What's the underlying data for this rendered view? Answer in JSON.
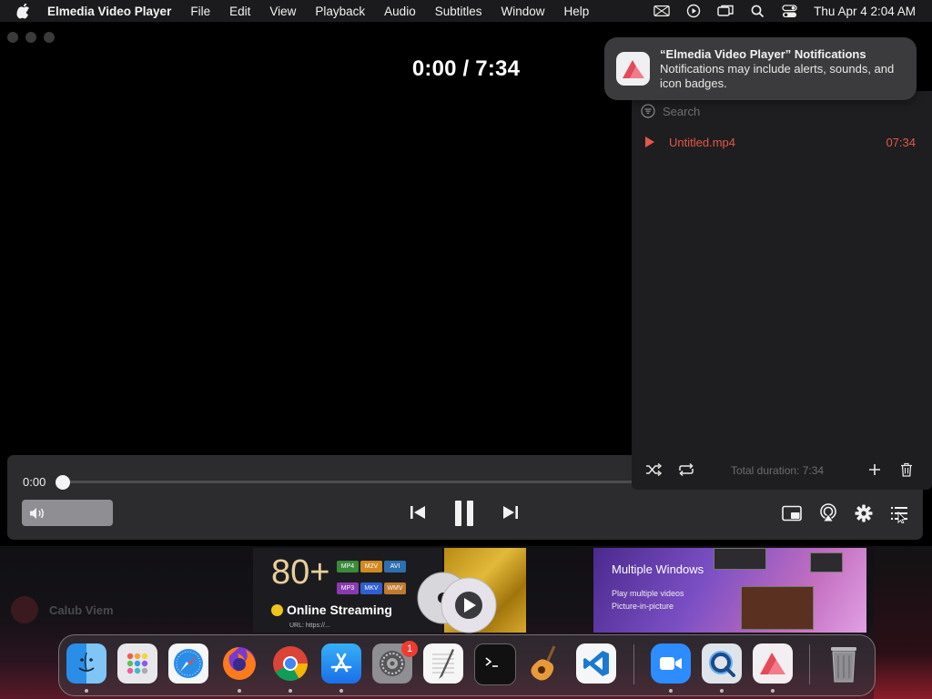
{
  "menubar": {
    "app_name": "Elmedia Video Player",
    "items": [
      "File",
      "Edit",
      "View",
      "Playback",
      "Audio",
      "Subtitles",
      "Window",
      "Help"
    ],
    "clock": "Thu Apr 4  2:04 AM"
  },
  "player": {
    "time_display": "0:00 / 7:34",
    "current_time": "0:00",
    "progress": 0,
    "volume": 1.0
  },
  "playlist": {
    "search_placeholder": "Search",
    "items": [
      {
        "name": "Untitled.mp4",
        "duration": "07:34"
      }
    ],
    "total_duration": "Total duration: 7:34"
  },
  "notification": {
    "title": "“Elmedia Video Player” Notifications",
    "body": "Notifications may include alerts, sounds, and icon badges."
  },
  "desktop": {
    "faded_label": "Calub Viem"
  },
  "promo": {
    "count": "80+",
    "formats": [
      "MP4",
      "M2V",
      "AVI",
      "MP3",
      "MKV",
      "WMV"
    ],
    "streaming": "Online Streaming",
    "url_label": "URL: https://...",
    "multiple_windows_title": "Multiple Windows",
    "multiple_windows_lines": [
      "Play multiple videos",
      "Picture-in-picture"
    ]
  },
  "dock": {
    "apps": [
      "Finder",
      "Launchpad",
      "Safari",
      "Firefox",
      "Chrome",
      "App Store",
      "System Settings",
      "TextEdit",
      "Terminal",
      "GarageBand",
      "Visual Studio Code",
      "Zoom",
      "QuickTime Player",
      "Elmedia Video Player",
      "Trash"
    ],
    "settings_badge": "1"
  },
  "colors": {
    "accent_red": "#e4574a",
    "control_bar": "#2c2c2e",
    "playlist_bg": "#1e1e20"
  }
}
